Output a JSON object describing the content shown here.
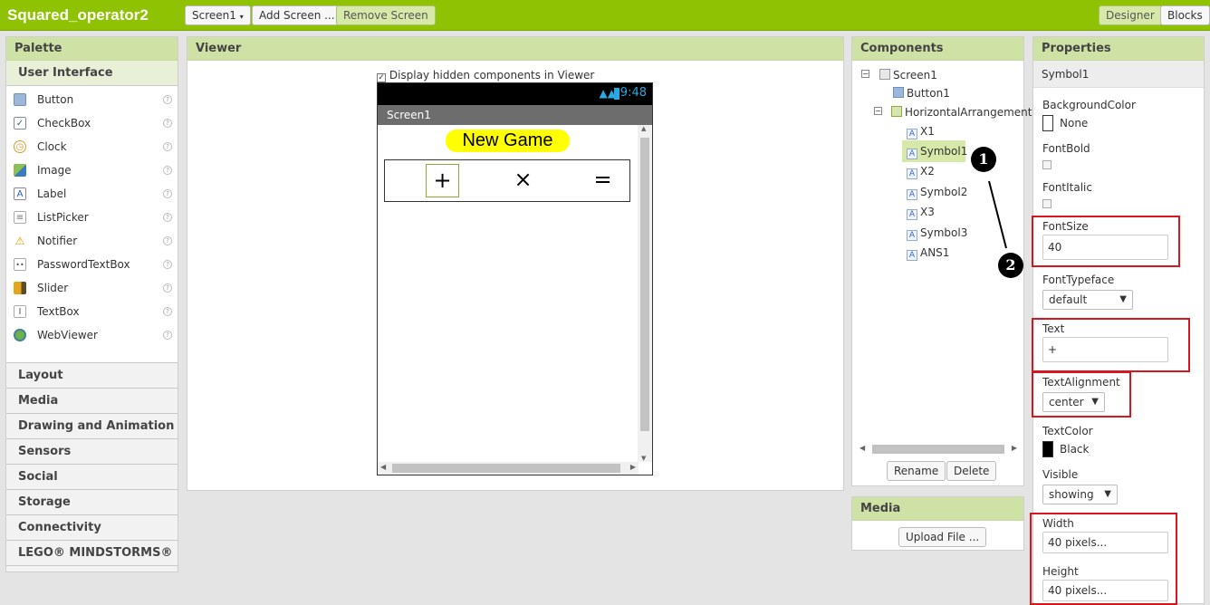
{
  "app": {
    "project_name": "Squared_operator2",
    "screen_selector": "Screen1",
    "add_screen": "Add Screen ...",
    "remove_screen": "Remove Screen",
    "designer": "Designer",
    "blocks": "Blocks"
  },
  "palette": {
    "title": "Palette",
    "open_category": "User Interface",
    "items": [
      {
        "label": "Button",
        "icon": "button-icon"
      },
      {
        "label": "CheckBox",
        "icon": "checkbox-icon"
      },
      {
        "label": "Clock",
        "icon": "clock-icon"
      },
      {
        "label": "Image",
        "icon": "image-icon"
      },
      {
        "label": "Label",
        "icon": "label-icon"
      },
      {
        "label": "ListPicker",
        "icon": "listpicker-icon"
      },
      {
        "label": "Notifier",
        "icon": "notifier-icon"
      },
      {
        "label": "PasswordTextBox",
        "icon": "password-icon"
      },
      {
        "label": "Slider",
        "icon": "slider-icon"
      },
      {
        "label": "TextBox",
        "icon": "textbox-icon"
      },
      {
        "label": "WebViewer",
        "icon": "webviewer-icon"
      }
    ],
    "categories": [
      "Layout",
      "Media",
      "Drawing and Animation",
      "Sensors",
      "Social",
      "Storage",
      "Connectivity",
      "LEGO® MINDSTORMS®"
    ]
  },
  "viewer": {
    "title": "Viewer",
    "hidden_label": "Display hidden components in Viewer",
    "status_time": "9:48",
    "screen_title": "Screen1",
    "new_game": "New Game",
    "symbols": [
      "+",
      "×",
      "="
    ]
  },
  "components": {
    "title": "Components",
    "tree": {
      "screen": "Screen1",
      "button": "Button1",
      "arrangement": "HorizontalArrangement1",
      "children": [
        "X1",
        "Symbol1",
        "X2",
        "Symbol2",
        "X3",
        "Symbol3",
        "ANS1"
      ],
      "selected": "Symbol1"
    },
    "rename": "Rename",
    "delete": "Delete"
  },
  "media": {
    "title": "Media",
    "upload": "Upload File ..."
  },
  "properties": {
    "title": "Properties",
    "component": "Symbol1",
    "background_color": {
      "label": "BackgroundColor",
      "value": "None"
    },
    "font_bold": {
      "label": "FontBold"
    },
    "font_italic": {
      "label": "FontItalic"
    },
    "font_size": {
      "label": "FontSize",
      "value": "40"
    },
    "font_typeface": {
      "label": "FontTypeface",
      "value": "default"
    },
    "text": {
      "label": "Text",
      "value": "+"
    },
    "text_alignment": {
      "label": "TextAlignment",
      "value": "center"
    },
    "text_color": {
      "label": "TextColor",
      "value": "Black"
    },
    "visible": {
      "label": "Visible",
      "value": "showing"
    },
    "width": {
      "label": "Width",
      "value": "40 pixels..."
    },
    "height": {
      "label": "Height",
      "value": "40 pixels..."
    }
  },
  "annotations": {
    "marker_1": "1",
    "marker_2": "2"
  },
  "colors": {
    "topbar": "#8fc202",
    "panel_header": "#cfe2a5",
    "highlight": "#d9151f",
    "new_game_bg": "#ffff00"
  }
}
